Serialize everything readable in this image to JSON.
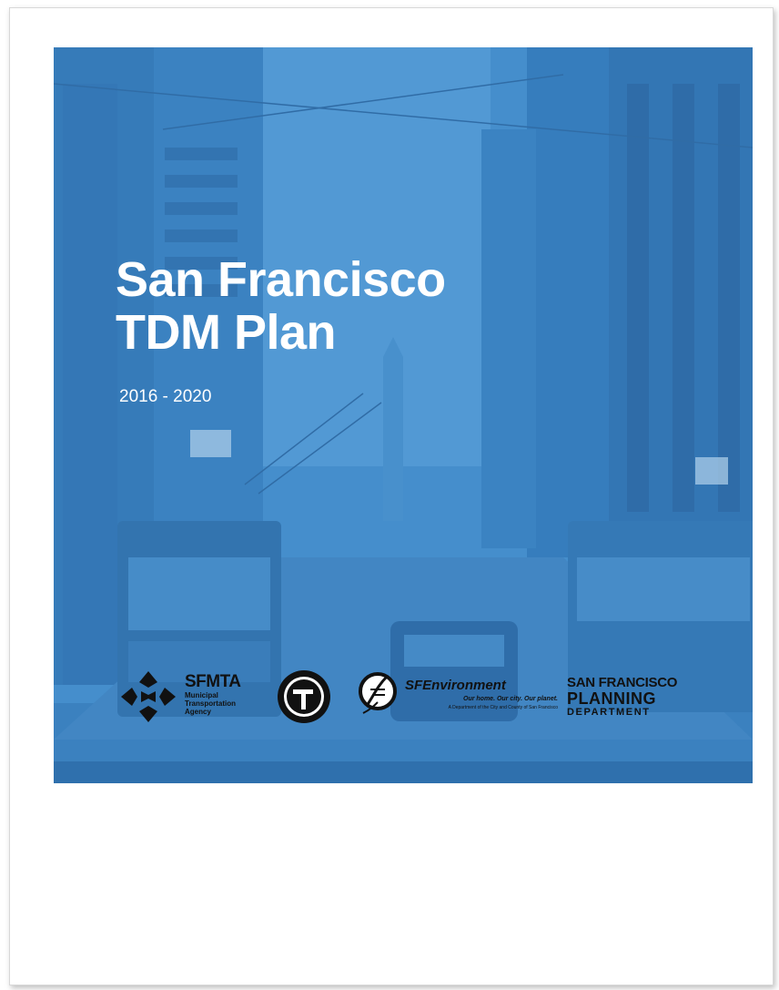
{
  "cover": {
    "title_line1": "San Francisco",
    "title_line2": "TDM Plan",
    "subtitle": "2016 - 2020"
  },
  "colors": {
    "hero_blue": "#3d86c6",
    "band_blue": "#2f70ad"
  },
  "logos": {
    "sfmta": {
      "name": "SFMTA",
      "sub_line1": "Municipal",
      "sub_line2": "Transportation",
      "sub_line3": "Agency"
    },
    "sf_environment": {
      "name": "SFEnvironment",
      "tagline": "Our home. Our city. Our planet.",
      "department": "A Department of the City and County of San Francisco"
    },
    "planning": {
      "line1": "SAN FRANCISCO",
      "line2": "PLANNING",
      "line3": "DEPARTMENT"
    },
    "icons": [
      "sfmta-logo-icon",
      "transportation-authority-seal-icon",
      "sf-environment-logo-icon"
    ]
  }
}
